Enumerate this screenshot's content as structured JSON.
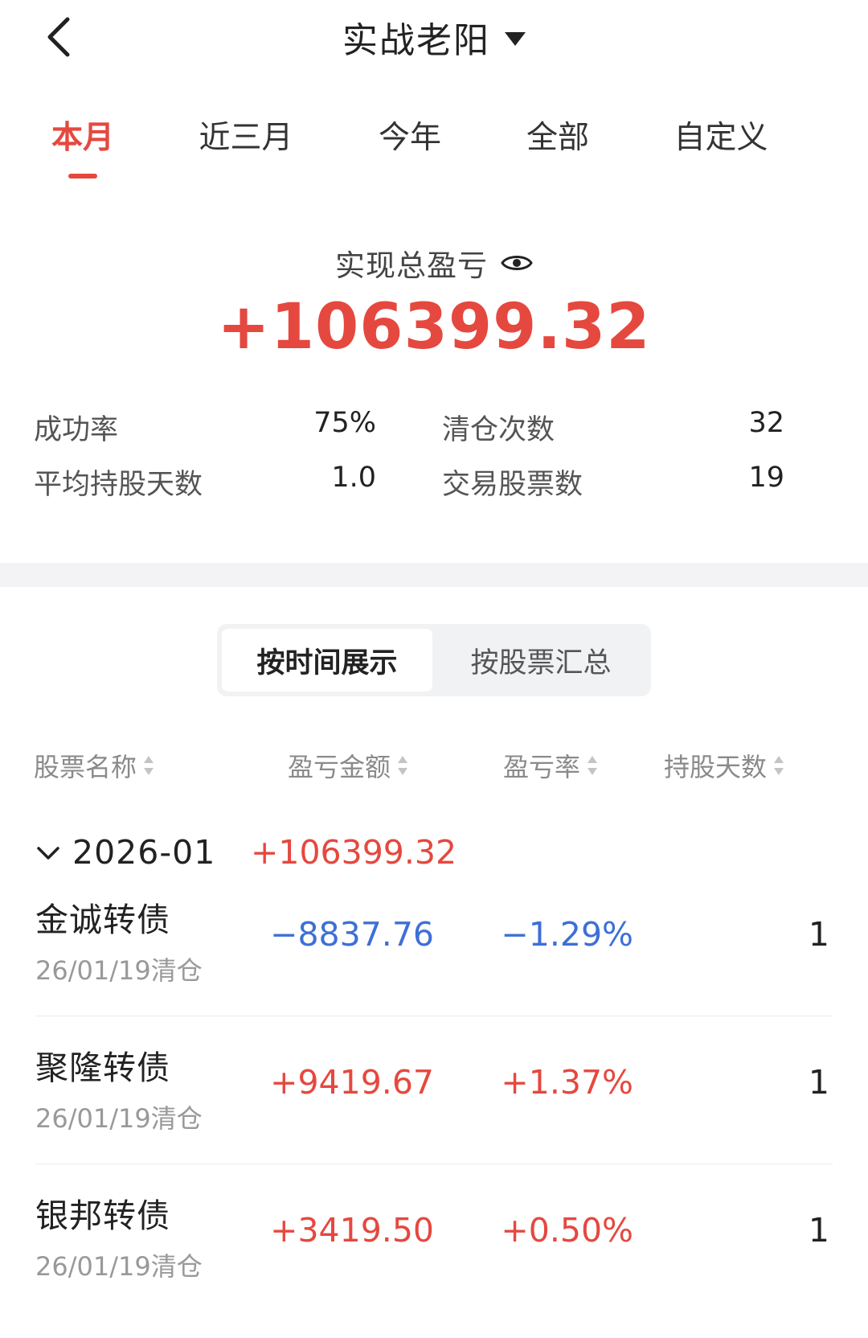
{
  "header": {
    "title": "实战老阳"
  },
  "tabs": [
    {
      "label": "本月"
    },
    {
      "label": "近三月"
    },
    {
      "label": "今年"
    },
    {
      "label": "全部"
    },
    {
      "label": "自定义"
    }
  ],
  "summary": {
    "label": "实现总盈亏",
    "total": "+106399.32",
    "stats": [
      {
        "label": "成功率",
        "value": "75%"
      },
      {
        "label": "清仓次数",
        "value": "32"
      },
      {
        "label": "平均持股天数",
        "value": "1.0"
      },
      {
        "label": "交易股票数",
        "value": "19"
      }
    ]
  },
  "view_toggle": {
    "by_time": "按时间展示",
    "by_stock": "按股票汇总"
  },
  "columns": [
    {
      "label": "股票名称"
    },
    {
      "label": "盈亏金额"
    },
    {
      "label": "盈亏率"
    },
    {
      "label": "持股天数"
    }
  ],
  "group": {
    "date": "2026-01",
    "total": "+106399.32"
  },
  "rows": [
    {
      "name": "金诚转债",
      "date": "26/01/19清仓",
      "amount": "−8837.76",
      "rate": "−1.29%",
      "days": "1"
    },
    {
      "name": "聚隆转债",
      "date": "26/01/19清仓",
      "amount": "+9419.67",
      "rate": "+1.37%",
      "days": "1"
    },
    {
      "name": "银邦转债",
      "date": "26/01/19清仓",
      "amount": "+3419.50",
      "rate": "+0.50%",
      "days": "1"
    }
  ],
  "colors": {
    "profit": "#e5483f",
    "loss": "#3d6fd6",
    "accent": "#e5483f"
  }
}
